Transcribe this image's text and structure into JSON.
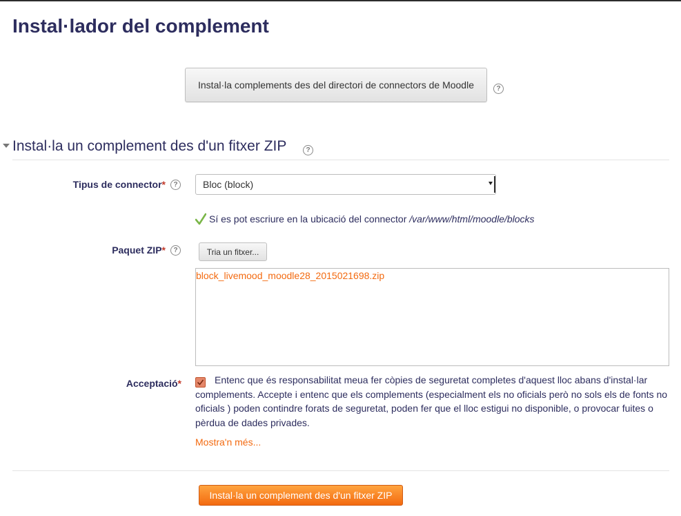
{
  "page": {
    "title": "Instal·lador del complement"
  },
  "directory": {
    "button_label": "Instal·la complements des del directori de connectors de Moodle",
    "help_icon": "question-circle-icon"
  },
  "zip_section": {
    "title": "Instal·la un complement des d'un fitxer ZIP",
    "collapse_icon": "triangle-down-icon",
    "plugin_type": {
      "label": "Tipus de connector",
      "required_marker": "*",
      "selected": "Bloc (block)"
    },
    "write_status": {
      "message": "Sí es pot escriure en la ubicació del connector",
      "path": "/var/www/html/moodle/blocks",
      "icon": "checkmark-icon"
    },
    "zip_package": {
      "label": "Paquet ZIP",
      "required_marker": "*",
      "choose_button": "Tria un fitxer...",
      "file_name": "block_livemood_moodle28_2015021698.zip"
    },
    "acknowledgement": {
      "label": "Acceptació",
      "required_marker": "*",
      "checked": true,
      "text": "Entenc que és responsabilitat meua fer còpies de seguretat completes d'aquest lloc abans d'instal·lar complements. Accepte i entenc que els complements (especialment els no oficials però no sols els de fonts no oficials ) poden contindre forats de seguretat, poden fer que el lloc estigui no disponible, o provocar fuites o pèrdua de dades privades.",
      "more_link": "Mostra'n més..."
    },
    "submit_button": "Instal·la un complement des d'un fitxer ZIP"
  },
  "colors": {
    "heading": "#2d2d5e",
    "accent": "#f36a10",
    "required": "#c23a2a",
    "success": "#7ab648"
  }
}
